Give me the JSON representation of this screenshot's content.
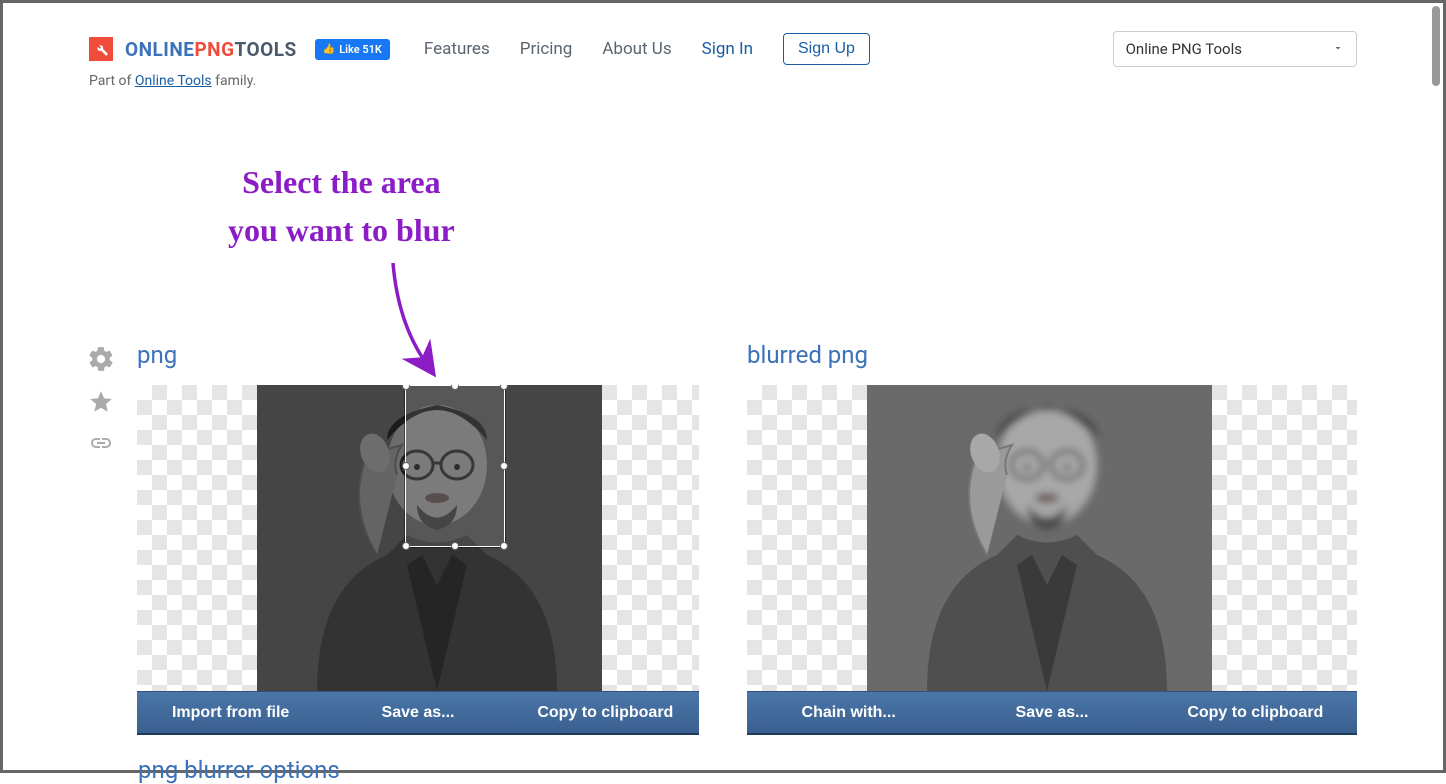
{
  "brand": {
    "part1": "ONLINE",
    "part2": "PNG",
    "part3": "TOOLS",
    "subtext_prefix": "Part of ",
    "subtext_link": "Online Tools",
    "subtext_suffix": " family."
  },
  "fb_like": "Like 51K",
  "nav": {
    "features": "Features",
    "pricing": "Pricing",
    "about": "About Us",
    "signin": "Sign In",
    "signup": "Sign Up"
  },
  "tool_select": "Online PNG Tools",
  "annotation": {
    "line1": "Select the area",
    "line2": "you want to blur"
  },
  "panels": {
    "left_title": "png",
    "right_title": "blurred png"
  },
  "actions": {
    "left": {
      "import": "Import from file",
      "save": "Save as...",
      "copy": "Copy to clipboard"
    },
    "right": {
      "chain": "Chain with...",
      "save": "Save as...",
      "copy": "Copy to clipboard"
    }
  },
  "options_title": "png blurrer options",
  "colors": {
    "accent_blue": "#3b72b9",
    "accent_red": "#f04c3c",
    "annotation_purple": "#8b1cc6",
    "bar_blue": "#4a76a8"
  }
}
